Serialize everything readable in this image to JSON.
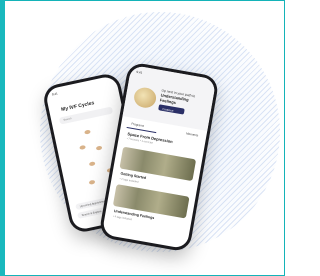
{
  "back_phone": {
    "status_time": "9:41",
    "title": "My IVF Cycles",
    "search_placeholder": "Search",
    "bottom_items": [
      "Upcoming Appointments",
      "Search & Explore"
    ]
  },
  "front_phone": {
    "status_time": "9:41",
    "hero_kicker": "Up next in your path to",
    "hero_title": "Understanding Feelings",
    "hero_button": "Continue",
    "tabs": [
      "Programs",
      "Moments"
    ],
    "section_title": "Space From Depression",
    "section_sub": "• 7 lessons • 1 exercise",
    "card1_title": "Getting Started",
    "card1_sub": "• 2 tags included",
    "card2_title": "Understanding Feelings",
    "card2_sub": "• 4 tags included"
  }
}
